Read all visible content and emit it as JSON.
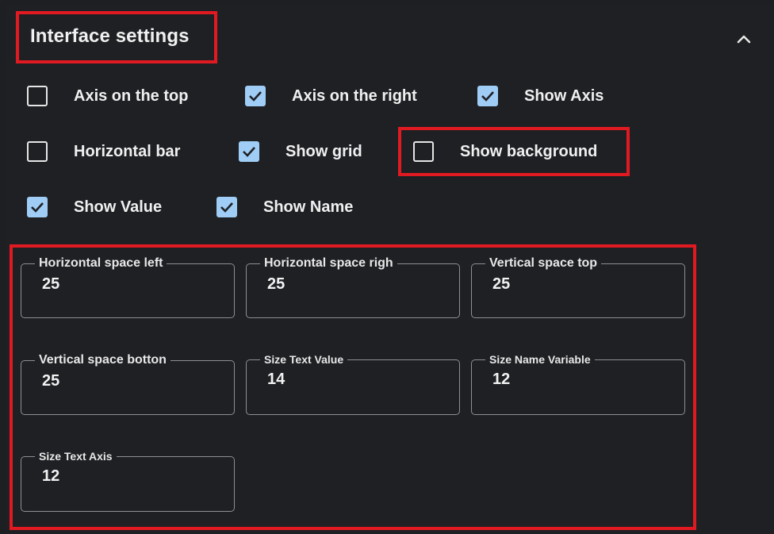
{
  "header": {
    "title": "Interface settings",
    "collapse_icon": "chevron-up-icon"
  },
  "checkboxes": {
    "axis_top": {
      "label": "Axis on the top",
      "checked": false
    },
    "axis_right": {
      "label": "Axis on the right",
      "checked": true
    },
    "show_axis": {
      "label": "Show Axis",
      "checked": true
    },
    "horizontal_bar": {
      "label": "Horizontal bar",
      "checked": false
    },
    "show_grid": {
      "label": "Show grid",
      "checked": true
    },
    "show_background": {
      "label": "Show background",
      "checked": false
    },
    "show_value": {
      "label": "Show Value",
      "checked": true
    },
    "show_name": {
      "label": "Show Name",
      "checked": true
    }
  },
  "fields": {
    "h_space_left": {
      "label": "Horizontal space left",
      "value": "25"
    },
    "h_space_right": {
      "label": "Horizontal space righ",
      "value": "25"
    },
    "v_space_top": {
      "label": "Vertical space top",
      "value": "25"
    },
    "v_space_bottom": {
      "label": "Vertical space botton",
      "value": "25"
    },
    "size_text_value": {
      "label": "Size Text Value",
      "value": "14"
    },
    "size_name_variable": {
      "label": "Size Name Variable",
      "value": "12"
    },
    "size_text_axis": {
      "label": "Size Text Axis",
      "value": "12"
    }
  },
  "colors": {
    "accent": "#9fcdf5",
    "highlight": "#e11a22",
    "background": "#1f2024"
  }
}
